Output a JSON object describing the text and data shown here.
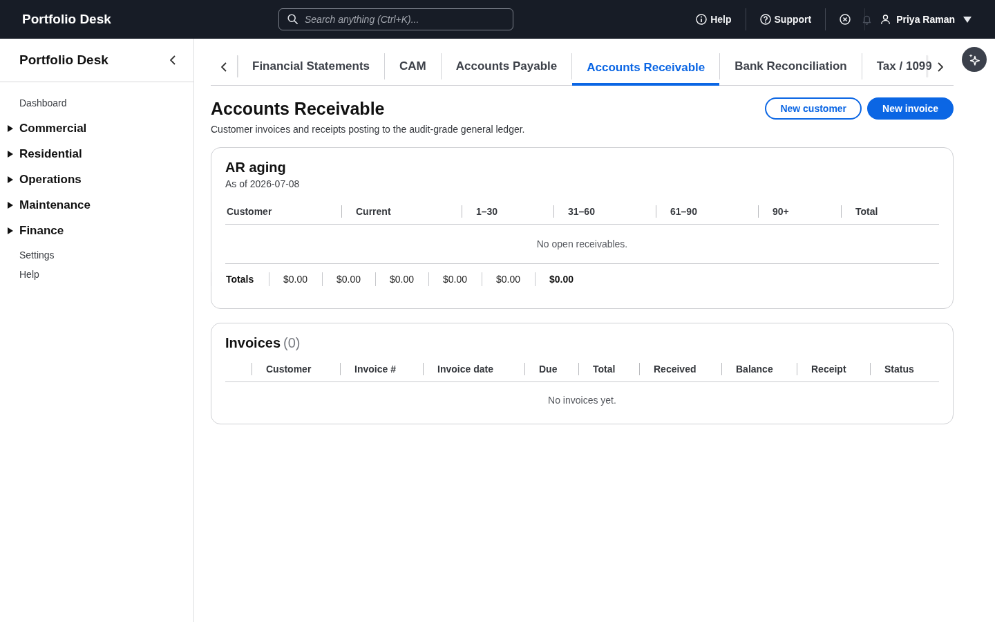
{
  "top_bar": {
    "brand": "Portfolio Desk",
    "search": {
      "placeholder": "Search anything (Ctrl+K)..."
    },
    "links": [
      {
        "kind": "info",
        "label": "Help"
      },
      {
        "kind": "question",
        "label": "Support"
      }
    ],
    "icon_buttons": [
      {
        "kind": "close",
        "disabled": false
      },
      {
        "kind": "bell",
        "disabled": true
      }
    ],
    "user": {
      "name": "Priya Raman"
    }
  },
  "sidebar": {
    "title": "Portfolio Desk",
    "items": [
      {
        "kind": "link",
        "label": "Dashboard"
      },
      {
        "kind": "group",
        "label": "Commercial",
        "expanded": false
      },
      {
        "kind": "group",
        "label": "Residential",
        "expanded": false
      },
      {
        "kind": "group",
        "label": "Operations",
        "expanded": false
      },
      {
        "kind": "group",
        "label": "Maintenance",
        "expanded": false
      },
      {
        "kind": "group",
        "label": "Finance",
        "expanded": false
      },
      {
        "kind": "link",
        "label": "Settings"
      },
      {
        "kind": "link",
        "label": "Help"
      }
    ]
  },
  "tabs": [
    {
      "label": "Financial Statements",
      "selected": false
    },
    {
      "label": "CAM",
      "selected": false
    },
    {
      "label": "Accounts Payable",
      "selected": false
    },
    {
      "label": "Accounts Receivable",
      "selected": true
    },
    {
      "label": "Bank Reconciliation",
      "selected": false
    },
    {
      "label": "Tax / 1099",
      "selected": false
    }
  ],
  "page": {
    "title": "Accounts Receivable",
    "subtitle": "Customer invoices and receipts posting to the audit-grade general ledger.",
    "actions": [
      {
        "kind": "outline",
        "label": "New customer"
      },
      {
        "kind": "primary",
        "label": "New invoice"
      }
    ]
  },
  "aging": {
    "title": "AR aging",
    "as_of": "As of 2026-07-08",
    "columns": [
      "Customer",
      "Current",
      "1–30",
      "31–60",
      "61–90",
      "90+",
      "Total"
    ],
    "empty_message": "No open receivables.",
    "totals": {
      "label": "Totals",
      "values": [
        "$0.00",
        "$0.00",
        "$0.00",
        "$0.00",
        "$0.00"
      ],
      "grand_total": "$0.00"
    }
  },
  "invoices": {
    "title": "Invoices",
    "count": "(0)",
    "columns": [
      "Customer",
      "Invoice #",
      "Invoice date",
      "Due",
      "Total",
      "Received",
      "Balance",
      "Receipt",
      "Status"
    ],
    "empty_message": "No invoices yet."
  }
}
